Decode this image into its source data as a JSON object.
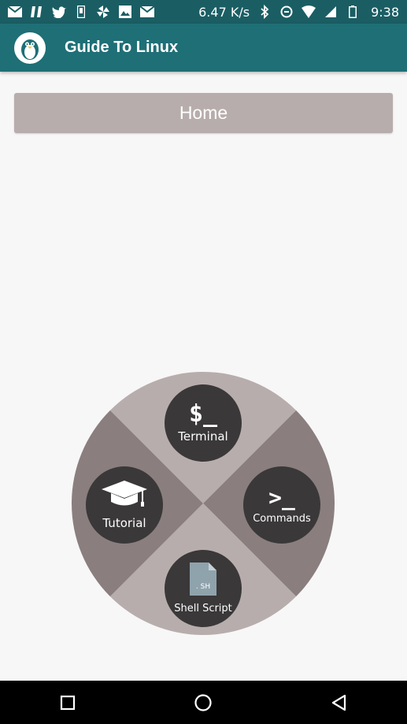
{
  "status_bar": {
    "network_speed": "6.47 K/s",
    "time": "9:38"
  },
  "app_bar": {
    "title": "Guide To Linux"
  },
  "home": {
    "label": "Home"
  },
  "wheel": {
    "terminal": {
      "label": "Terminal",
      "glyph": "$_"
    },
    "commands": {
      "label": "Commands",
      "glyph": ">_"
    },
    "tutorial": {
      "label": "Tutorial"
    },
    "shell_script": {
      "label": "Shell Script",
      "file_ext": ". SH"
    }
  },
  "colors": {
    "status_bar": "#1a5e64",
    "app_bar": "#1f6f76",
    "home_button": "#b8adad",
    "wheel_light": "#b8adad",
    "wheel_dark": "#8a7e7e",
    "wheel_button": "#3a3838"
  }
}
